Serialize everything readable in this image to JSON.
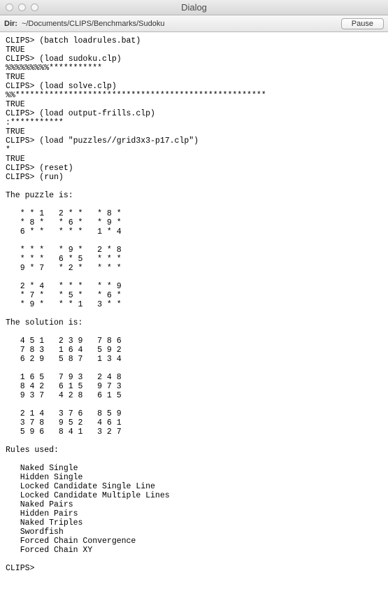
{
  "window": {
    "title": "Dialog"
  },
  "toolbar": {
    "dir_label": "Dir:",
    "dir_path": "~/Documents/CLIPS/Benchmarks/Sudoku",
    "pause_label": "Pause"
  },
  "terminal": {
    "content": "CLIPS> (batch loadrules.bat)\nTRUE\nCLIPS> (load sudoku.clp)\n%%%%%%%%%***********\nTRUE\nCLIPS> (load solve.clp)\n%%****************************************************\nTRUE\nCLIPS> (load output-frills.clp)\n:***********\nTRUE\nCLIPS> (load \"puzzles//grid3x3-p17.clp\")\n*\nTRUE\nCLIPS> (reset)\nCLIPS> (run)\n\nThe puzzle is:\n\n   * * 1   2 * *   * 8 *\n   * 8 *   * 6 *   * 9 *\n   6 * *   * * *   1 * 4\n\n   * * *   * 9 *   2 * 8\n   * * *   6 * 5   * * *\n   9 * 7   * 2 *   * * *\n\n   2 * 4   * * *   * * 9\n   * 7 *   * 5 *   * 6 *\n   * 9 *   * * 1   3 * *\n\nThe solution is:\n\n   4 5 1   2 3 9   7 8 6\n   7 8 3   1 6 4   5 9 2\n   6 2 9   5 8 7   1 3 4\n\n   1 6 5   7 9 3   2 4 8\n   8 4 2   6 1 5   9 7 3\n   9 3 7   4 2 8   6 1 5\n\n   2 1 4   3 7 6   8 5 9\n   3 7 8   9 5 2   4 6 1\n   5 9 6   8 4 1   3 2 7\n\nRules used:\n\n   Naked Single\n   Hidden Single\n   Locked Candidate Single Line\n   Locked Candidate Multiple Lines\n   Naked Pairs\n   Hidden Pairs\n   Naked Triples\n   Swordfish\n   Forced Chain Convergence\n   Forced Chain XY\n\nCLIPS> "
  }
}
